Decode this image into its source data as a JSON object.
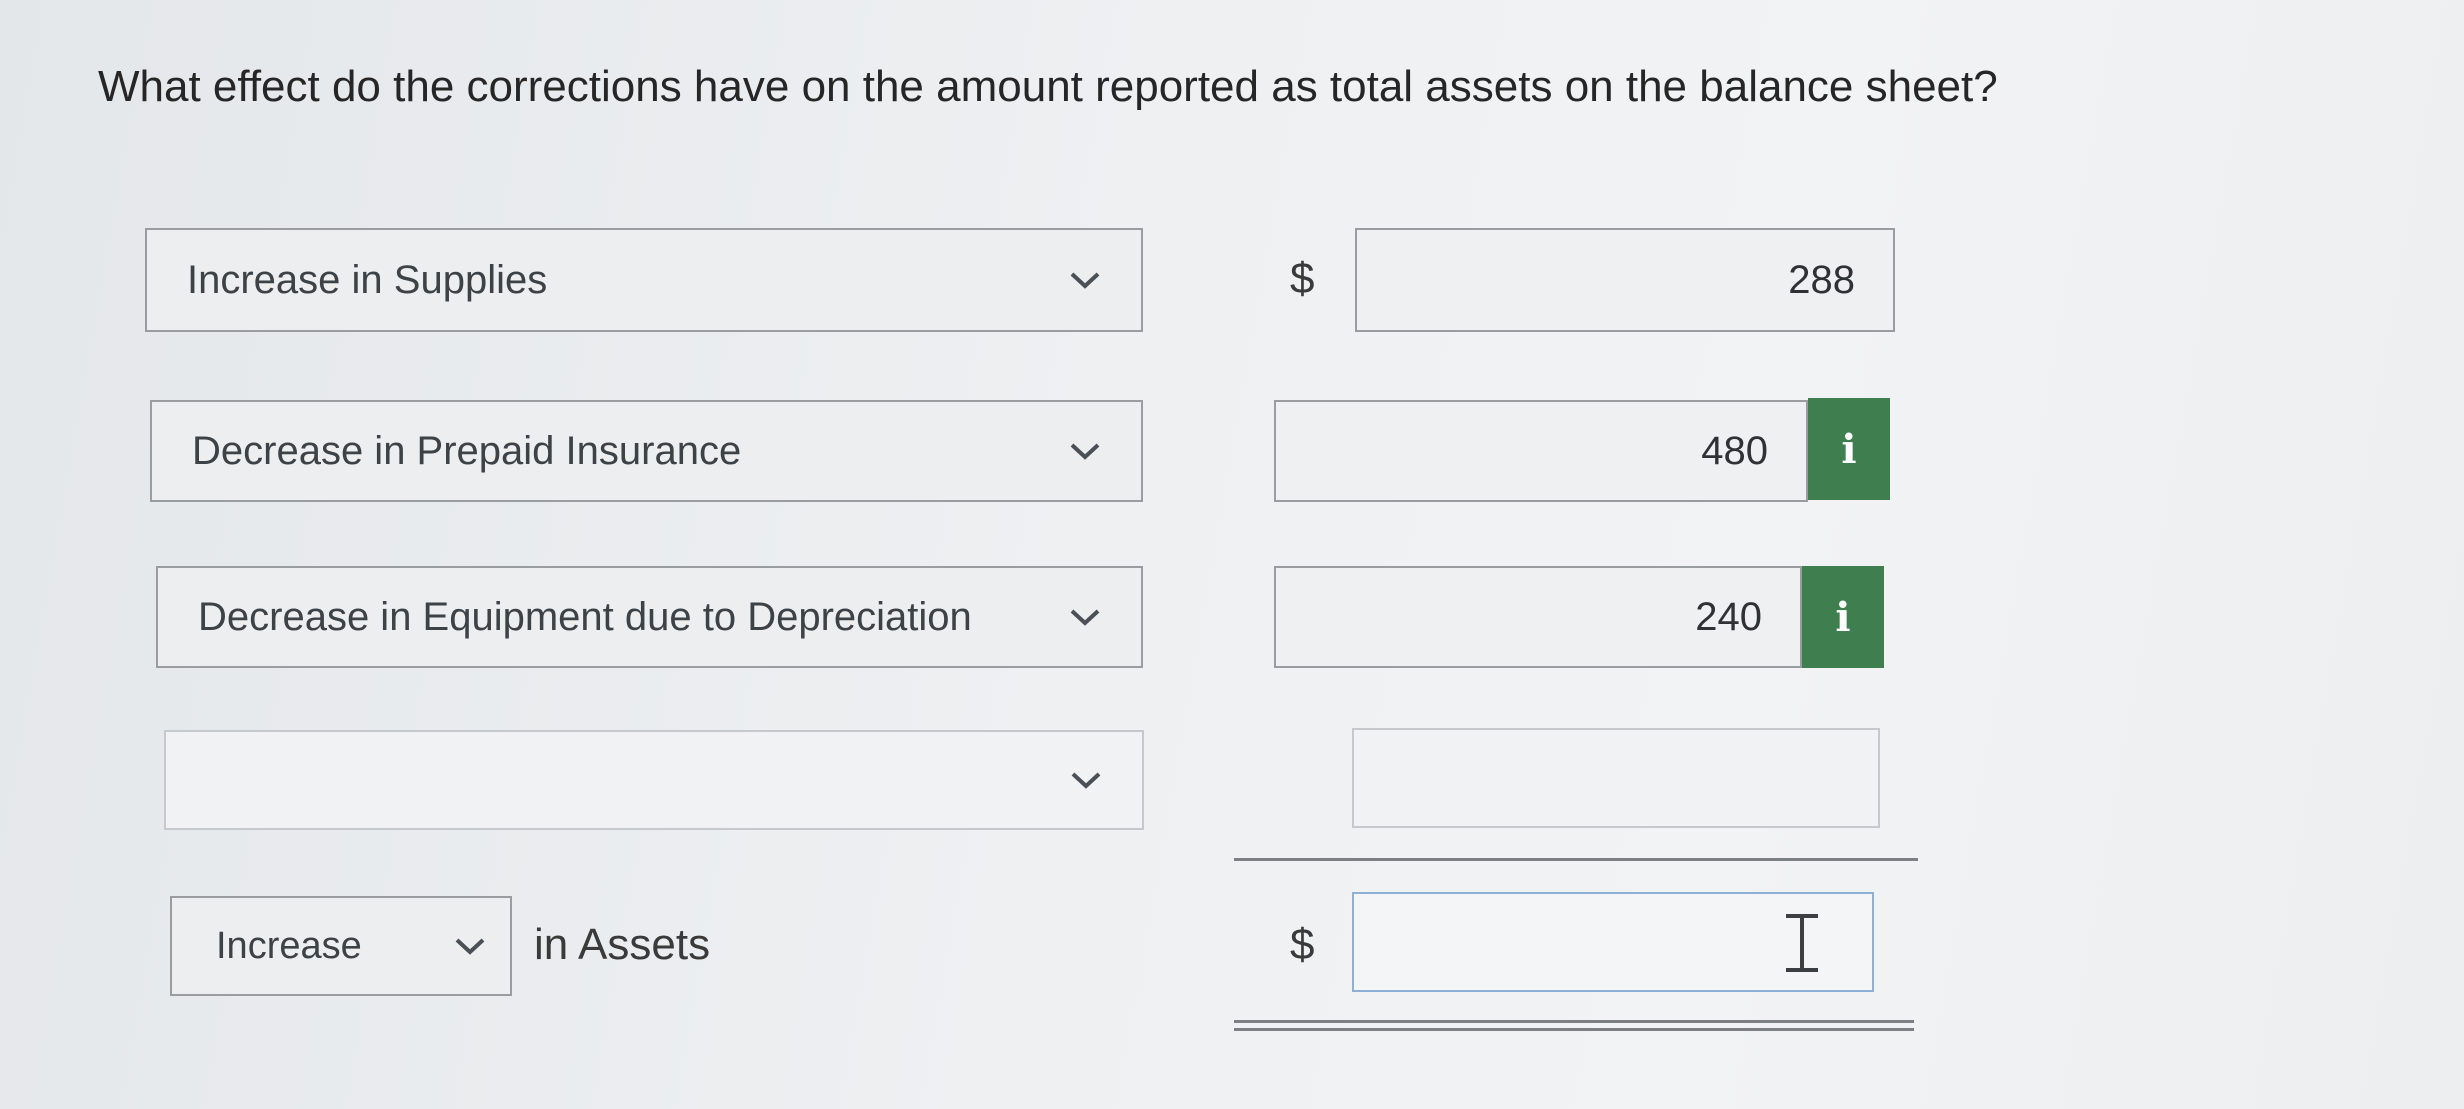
{
  "question": "What effect do the corrections have on the amount reported as total assets on the balance sheet?",
  "rows": [
    {
      "select": "Increase in Supplies",
      "value": "288",
      "currency": "$"
    },
    {
      "select": "Decrease in Prepaid Insurance",
      "value": "480",
      "info": "i"
    },
    {
      "select": "Decrease in Equipment due to Depreciation",
      "value": "240",
      "info": "i"
    },
    {
      "select": "",
      "value": ""
    }
  ],
  "total": {
    "direction": "Increase",
    "suffix": "in Assets",
    "currency": "$",
    "value": ""
  },
  "colors": {
    "info_badge": "#3f7e4e",
    "field_border": "#9a9d9f",
    "active_border": "#8fb0d6"
  }
}
